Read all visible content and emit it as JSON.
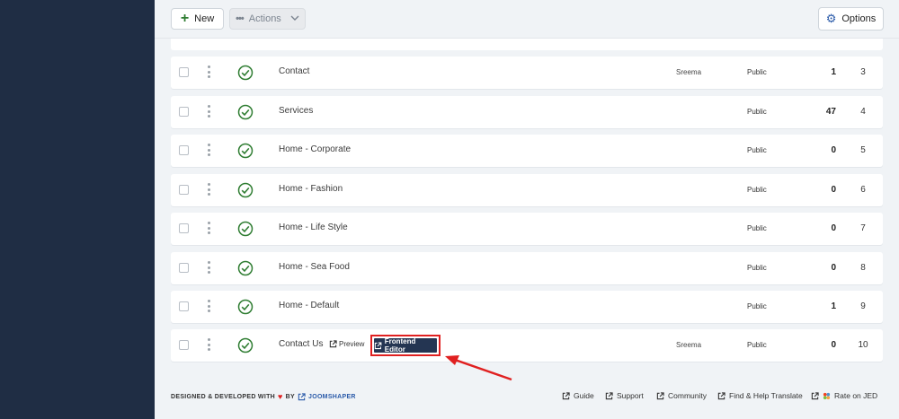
{
  "toolbar": {
    "new_label": "New",
    "actions_label": "Actions",
    "options_label": "Options"
  },
  "rows": [
    {
      "title": "Contact",
      "author": "Sreema",
      "access": "Public",
      "hits": "1",
      "id": "3"
    },
    {
      "title": "Services",
      "author": "",
      "access": "Public",
      "hits": "47",
      "id": "4"
    },
    {
      "title": "Home - Corporate",
      "author": "",
      "access": "Public",
      "hits": "0",
      "id": "5"
    },
    {
      "title": "Home - Fashion",
      "author": "",
      "access": "Public",
      "hits": "0",
      "id": "6"
    },
    {
      "title": "Home - Life Style",
      "author": "",
      "access": "Public",
      "hits": "0",
      "id": "7"
    },
    {
      "title": "Home - Sea Food",
      "author": "",
      "access": "Public",
      "hits": "0",
      "id": "8"
    },
    {
      "title": "Home - Default",
      "author": "",
      "access": "Public",
      "hits": "1",
      "id": "9"
    },
    {
      "title": "Contact Us",
      "author": "Sreema",
      "access": "Public",
      "hits": "0",
      "id": "10",
      "preview_label": "Preview",
      "frontend_editor_label": "Frontend Editor"
    }
  ],
  "footer": {
    "credit_text": "DESIGNED & DEVELOPED WITH",
    "by_text": "BY",
    "brand": "JOOMSHAPER",
    "links": [
      "Guide",
      "Support",
      "Community",
      "Find & Help Translate",
      "Rate on JED"
    ]
  },
  "colors": {
    "sidebar": "#1f2d44",
    "status_green": "#2f7d32",
    "frontend_editor_bg": "#243552",
    "highlight_red": "#e02020",
    "brand_blue": "#2a5aa9"
  }
}
